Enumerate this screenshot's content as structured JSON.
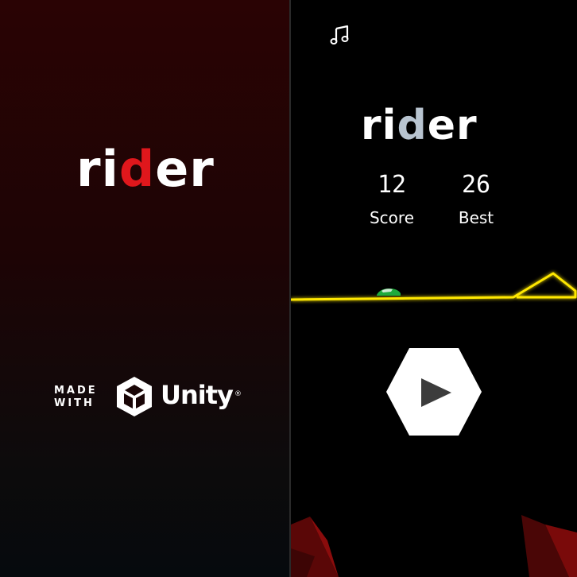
{
  "splash": {
    "logo": {
      "prefix": "ri",
      "accent": "d",
      "suffix": "er"
    },
    "made_with_line1": "MADE",
    "made_with_line2": "WITH",
    "engine_name": "Unity",
    "registered_mark": "®",
    "engine_icon": "unity-cube-icon"
  },
  "game": {
    "music_icon": "music-note-icon",
    "logo": {
      "prefix": "ri",
      "accent": "d",
      "suffix": "er"
    },
    "score": {
      "value": "12",
      "label": "Score"
    },
    "best": {
      "value": "26",
      "label": "Best"
    },
    "play_icon": "play-icon",
    "colors": {
      "track": "#ffe800",
      "car": "#1faa3c",
      "splash_accent": "#e0171c",
      "game_accent": "#b8c4d0"
    }
  }
}
